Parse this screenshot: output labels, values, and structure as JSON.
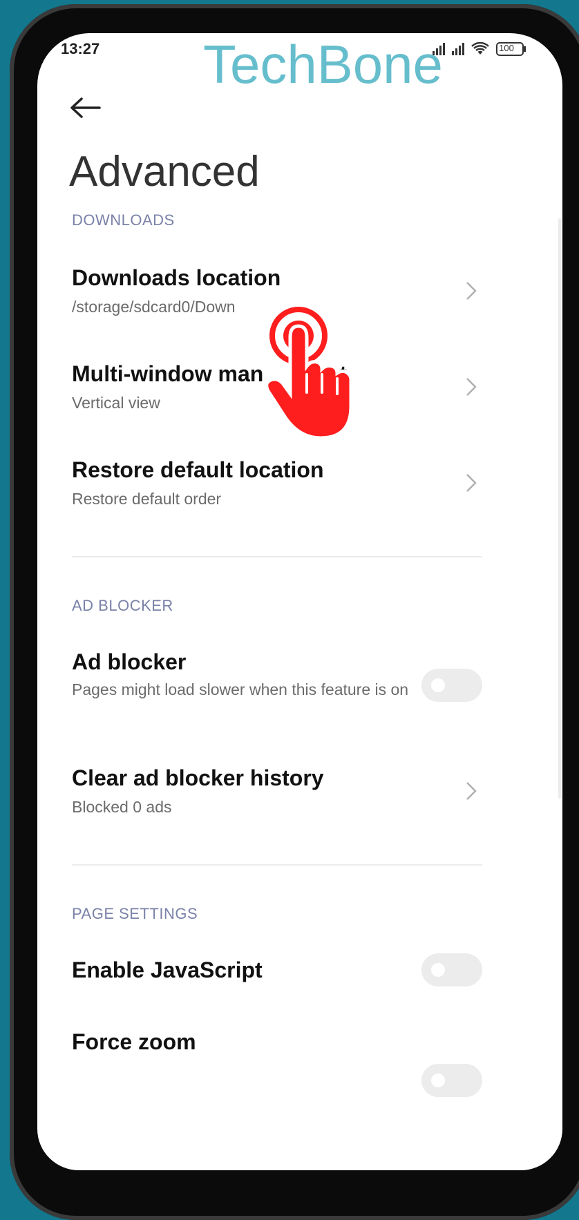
{
  "status": {
    "time": "13:27",
    "battery": "100"
  },
  "watermark": "TechBone",
  "header": {
    "title": "Advanced"
  },
  "sections": {
    "downloads": "DOWNLOADS",
    "ad_blocker": "AD BLOCKER",
    "page_settings": "PAGE SETTINGS"
  },
  "items": {
    "downloads_location": {
      "title": "Downloads location",
      "sub": "/storage/sdcard0/Down"
    },
    "multi_window": {
      "title": "Multi-window man",
      "title_end": "ent",
      "sub": "Vertical view"
    },
    "restore_default": {
      "title": "Restore default location",
      "sub": "Restore default order"
    },
    "ad_blocker": {
      "title": "Ad blocker",
      "sub": "Pages might load slower when this feature is on",
      "enabled": false
    },
    "clear_history": {
      "title": "Clear ad blocker history",
      "sub": "Blocked 0 ads"
    },
    "enable_js": {
      "title": "Enable JavaScript",
      "enabled": false
    },
    "force_zoom": {
      "title": "Force zoom",
      "enabled": false
    }
  },
  "colors": {
    "background": "#13788e",
    "watermark": "#5ab9c9",
    "section_header": "#7a82a8",
    "tap_hand": "#ff1e1e"
  }
}
